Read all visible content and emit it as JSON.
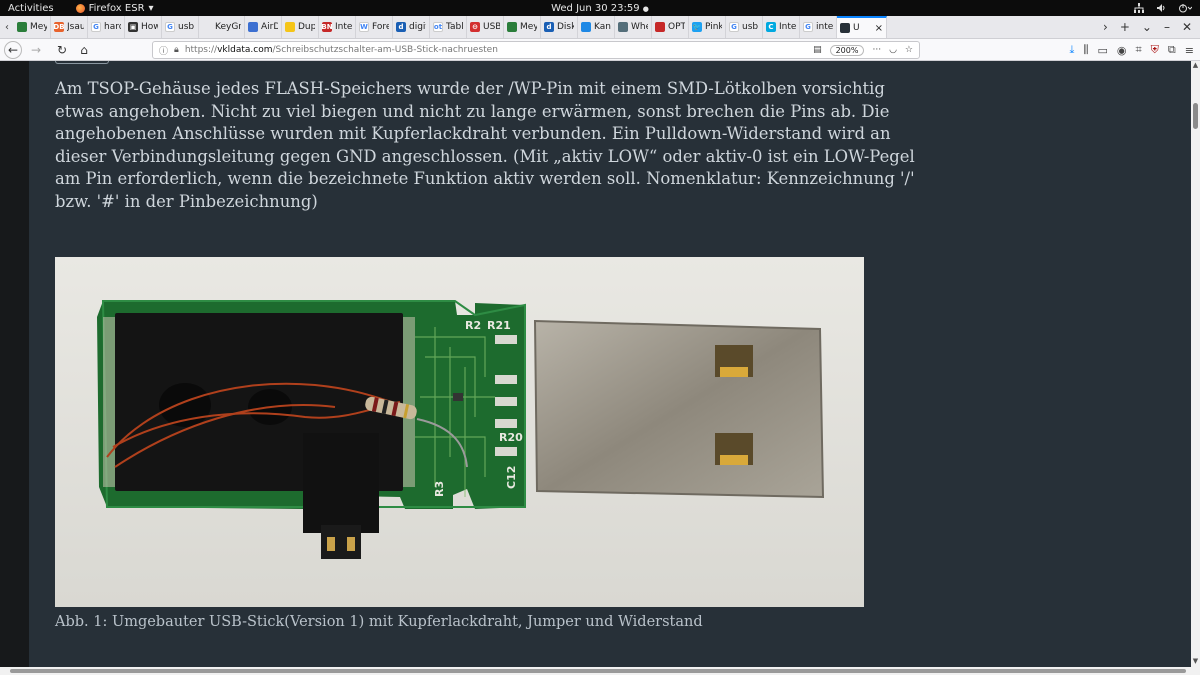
{
  "topbar": {
    "activities": "Activities",
    "app_name": "Firefox ESR",
    "app_menu_arrow": "▾",
    "clock": "Wed Jun 30  23:59",
    "clock_dot": "●",
    "network_icon": "network-icon",
    "volume_icon": "volume-icon",
    "power_icon": "power-icon"
  },
  "tabs": [
    {
      "title": "Mey",
      "color": "#2a7d3a",
      "glyph": ""
    },
    {
      "title": "Jsau",
      "color": "#e8622c",
      "glyph": "DB"
    },
    {
      "title": "hard",
      "color": "#ffffff",
      "glyph": "G"
    },
    {
      "title": "How",
      "color": "#333333",
      "glyph": "▣"
    },
    {
      "title": "usb",
      "color": "#ffffff",
      "glyph": "G"
    },
    {
      "title": "KeyGrab",
      "color": "",
      "glyph": ""
    },
    {
      "title": "AirD",
      "color": "#3c6fd1",
      "glyph": ""
    },
    {
      "title": "Dupl",
      "color": "#f5c518",
      "glyph": ""
    },
    {
      "title": "Inter",
      "color": "#c62828",
      "glyph": "BN"
    },
    {
      "title": "Fore",
      "color": "#ffffff",
      "glyph": "W"
    },
    {
      "title": "digit",
      "color": "#1a5fb4",
      "glyph": "d"
    },
    {
      "title": "Table",
      "color": "#ffffff",
      "glyph": "ot"
    },
    {
      "title": "USB",
      "color": "#d32f2f",
      "glyph": "⊖"
    },
    {
      "title": "Mey",
      "color": "#2a7d3a",
      "glyph": ""
    },
    {
      "title": "Disk",
      "color": "#1a5fb4",
      "glyph": "d"
    },
    {
      "title": "Kang",
      "color": "#1e88e5",
      "glyph": ""
    },
    {
      "title": "Whe",
      "color": "#546e7a",
      "glyph": ""
    },
    {
      "title": "OPT",
      "color": "#c62828",
      "glyph": ""
    },
    {
      "title": "Pinky",
      "color": "#1da1f2",
      "glyph": "🐦"
    },
    {
      "title": "usb",
      "color": "#ffffff",
      "glyph": "G"
    },
    {
      "title": "Inter",
      "color": "#00a9e0",
      "glyph": "C"
    },
    {
      "title": "inter",
      "color": "#ffffff",
      "glyph": "G"
    }
  ],
  "active_tab": {
    "title": "U",
    "close": "×"
  },
  "tab_controls": {
    "scroll_right": "›",
    "new_tab": "+",
    "list_tabs": "⌄",
    "minimize": "–",
    "close": "✕"
  },
  "nav": {
    "back": "←",
    "forward": "→",
    "reload": "↻",
    "home": "⌂",
    "url_scheme": "https://",
    "url_domain": "vkldata.com",
    "url_path": "/Schreibschutzschalter-am-USB-Stick-nachruesten",
    "zoom": "200%",
    "reader_icon": "reader-view-icon",
    "pocket_icon": "pocket-icon",
    "bookmark_icon": "bookmark-star-icon"
  },
  "article": {
    "paragraph": "Am TSOP-Gehäuse jedes FLASH-Speichers wurde der /WP-Pin mit einem SMD-Lötkolben vorsichtig etwas angehoben. Nicht zu viel biegen und nicht zu lange erwärmen, sonst brechen die Pins ab. Die angehobenen Anschlüsse wurden mit Kupferlackdraht verbunden. Ein Pulldown-Widerstand wird an dieser Verbindungsleitung gegen GND angeschlossen. (Mit „aktiv LOW“ oder aktiv-0 ist ein LOW-Pegel am Pin erforderlich, wenn die bezeichnete Funktion aktiv werden soll. Nomenklatur: Kennzeichnung '/' bzw. '#' in der Pinbezeichnung)",
    "photo_labels": [
      "R2",
      "R21",
      "R20",
      "R3",
      "C12"
    ],
    "caption": "Abb. 1: Umgebauter USB-Stick(Version 1) mit Kupferlackdraht, Jumper und Widerstand"
  },
  "colors": {
    "page_bg": "#273038",
    "text": "#cfd6dc",
    "caption": "#b9c2ca",
    "accent": "#0a84ff"
  }
}
